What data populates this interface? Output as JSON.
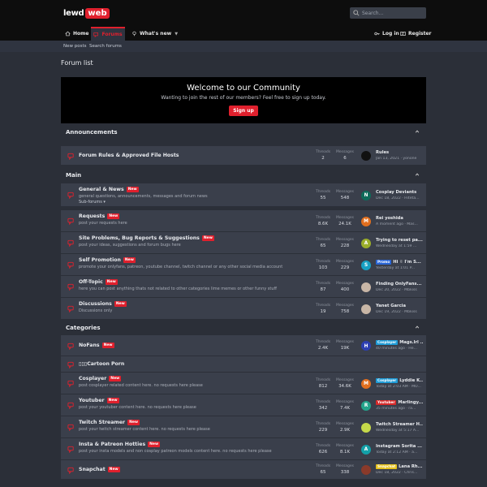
{
  "brand": {
    "part1": "lewd",
    "part2": "web"
  },
  "search": {
    "placeholder": "Search..."
  },
  "nav": {
    "home": "Home",
    "forums": "Forums",
    "whats_new": "What's new",
    "login": "Log in",
    "register": "Register"
  },
  "subnav": {
    "new_posts": "New posts",
    "search_forums": "Search forums"
  },
  "page_title": "Forum list",
  "welcome": {
    "title": "Welcome to our Community",
    "subtitle": "Wanting to join the rest of our members? Feel free to sign up today.",
    "button": "Sign up"
  },
  "labels": {
    "threads": "Threads",
    "messages": "Messages",
    "new_badge": "New"
  },
  "categories": {
    "announcements": "Announcements",
    "main": "Main",
    "categories": "Categories"
  },
  "nodes": [
    {
      "title": "Forum Rules & Approved File Hosts",
      "new": false,
      "desc": "",
      "sub": "",
      "threads": "2",
      "messages": "6",
      "last_title": "Rules",
      "last_meta": "Jan 13, 2021 · yonone",
      "avatar_letter": "",
      "avatar_color": "#111111",
      "prefix": ""
    },
    {
      "title": "General & News",
      "new": true,
      "desc": "general questions, announcements, messages and forum news",
      "sub": "Sub-forums",
      "threads": "55",
      "messages": "548",
      "last_title": "Cosplay Deviants",
      "last_meta": "Dec 18, 2022 · Hiteta...",
      "avatar_letter": "N",
      "avatar_color": "#0e6b5a",
      "prefix": ""
    },
    {
      "title": "Requests",
      "new": true,
      "desc": "post your requests here",
      "sub": "",
      "threads": "8.6K",
      "messages": "24.1K",
      "last_title": "Rei yoshida",
      "last_meta": "A moment ago · Mas...",
      "avatar_letter": "M",
      "avatar_color": "#e26f1e",
      "prefix": ""
    },
    {
      "title": "Site Problems, Bug Reports & Suggestions",
      "new": true,
      "desc": "post your ideas, suggestions and forum bugs here",
      "sub": "",
      "threads": "65",
      "messages": "228",
      "last_title": "Trying to reset pa...",
      "last_meta": "Wednesday at 1:59 ...",
      "avatar_letter": "A",
      "avatar_color": "#9bae2a",
      "prefix": ""
    },
    {
      "title": "Self Promotion",
      "new": true,
      "desc": "promote your onlyfans, patreon, youtube channel, twitch channel or any other social media account",
      "sub": "",
      "threads": "103",
      "messages": "229",
      "last_title": "Hi ✌ I'm S...",
      "last_meta": "Yesterday at 1:01 P...",
      "avatar_letter": "S",
      "avatar_color": "#17a0c4",
      "prefix": "Promo",
      "prefix_color": "#2a66d6"
    },
    {
      "title": "Off-Topic",
      "new": true,
      "desc": "here you can post anything thats not related to other categories lime memes or other funny stuff",
      "sub": "",
      "threads": "87",
      "messages": "400",
      "last_title": "Finding OnlyFans...",
      "last_meta": "Dec 20, 2022 · Mbkiss",
      "avatar_letter": "",
      "avatar_color": "#c8b6a6",
      "prefix": ""
    },
    {
      "title": "Discussions",
      "new": true,
      "desc": "Discussions only",
      "sub": "",
      "threads": "19",
      "messages": "758",
      "last_title": "Yanet Garcia",
      "last_meta": "Dec 19, 2022 · Mbkiss",
      "avatar_letter": "",
      "avatar_color": "#c8b6a6",
      "prefix": ""
    },
    {
      "title": "NoFans",
      "new": true,
      "desc": "",
      "sub": "",
      "threads": "2.4K",
      "messages": "19K",
      "last_title": "Mags.lrl ...",
      "last_meta": "40 minutes ago · He...",
      "avatar_letter": "H",
      "avatar_color": "#2d3fb0",
      "prefix": "Cosplayer",
      "prefix_color": "#1e9bd6"
    },
    {
      "title": "▯▯▯Cartoon Porn",
      "new": false,
      "desc": "",
      "sub": "",
      "threads": "",
      "messages": "",
      "last_title": "",
      "last_meta": "",
      "avatar_letter": "",
      "avatar_color": "",
      "prefix": ""
    },
    {
      "title": "Cosplayer",
      "new": true,
      "desc": "post cosplayer related content here. no requests here please",
      "sub": "",
      "threads": "812",
      "messages": "34.6K",
      "last_title": "Lyddie K...",
      "last_meta": "Today at 2:03 AM · MO...",
      "avatar_letter": "M",
      "avatar_color": "#e26f1e",
      "prefix": "Cosplayer",
      "prefix_color": "#1e9bd6"
    },
    {
      "title": "Youtuber",
      "new": true,
      "desc": "post your youtuber content here. no requests here please",
      "sub": "",
      "threads": "342",
      "messages": "7.4K",
      "last_title": "Marlingy...",
      "last_meta": "35 minutes ago · ra...",
      "avatar_letter": "R",
      "avatar_color": "#23a38b",
      "prefix": "Youtuber",
      "prefix_color": "#d62a2a"
    },
    {
      "title": "Twitch Streamer",
      "new": true,
      "desc": "post your twitch streamer content here. no requests here please",
      "sub": "",
      "threads": "229",
      "messages": "2.9K",
      "last_title": "Twitch Streamer H...",
      "last_meta": "Wednesday at 5:17 A...",
      "avatar_letter": "",
      "avatar_color": "#c6d94a",
      "prefix": ""
    },
    {
      "title": "Insta & Patreon Hotties",
      "new": true,
      "desc": "post your insta models and non cosplay patreon models content here. no requests here please",
      "sub": "",
      "threads": "626",
      "messages": "8.1K",
      "last_title": "Instagram Sorita ...",
      "last_meta": "Today at 2:12 AM · a...",
      "avatar_letter": "A",
      "avatar_color": "#13a0a8",
      "prefix": ""
    },
    {
      "title": "Snapchat",
      "new": true,
      "desc": "",
      "sub": "",
      "threads": "65",
      "messages": "338",
      "last_title": "Lana Rh...",
      "last_meta": "Dec 18, 2022 · Chris...",
      "avatar_letter": "",
      "avatar_color": "#8a3a2a",
      "prefix": "Snapchat",
      "prefix_color": "#e6c21c"
    }
  ]
}
